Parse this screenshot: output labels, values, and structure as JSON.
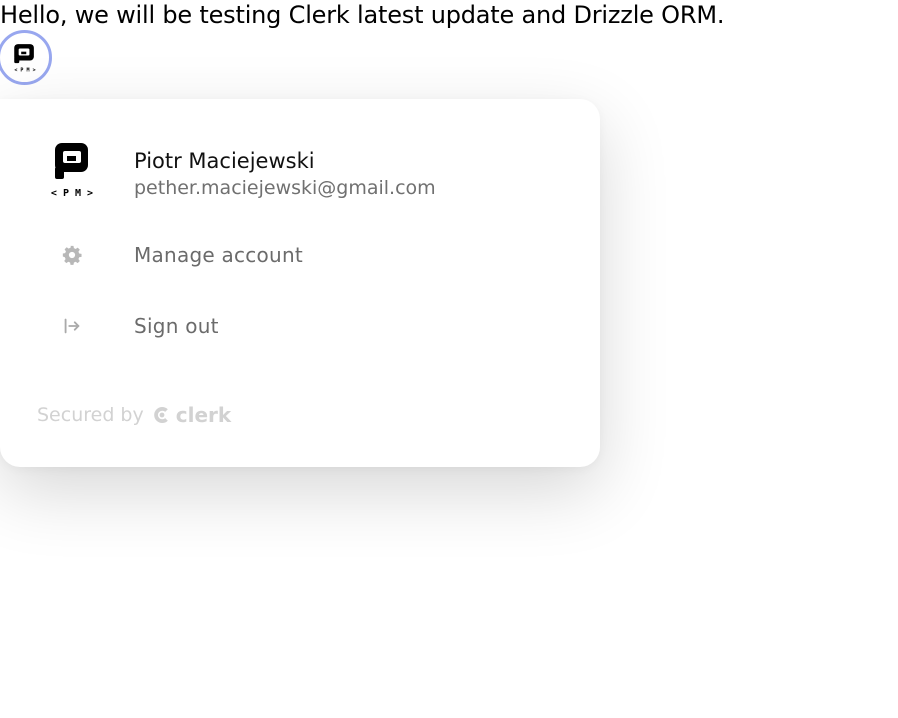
{
  "page": {
    "intro_text": "Hello, we will be testing Clerk latest update and Drizzle ORM."
  },
  "user_button": {
    "avatar_icon": "pm-logo-icon",
    "ring_color": "#98a7ef"
  },
  "popover": {
    "user": {
      "name": "Piotr Maciejewski",
      "email": "pether.maciejewski@gmail.com",
      "avatar_icon": "pm-logo-icon"
    },
    "menu": [
      {
        "label": "Manage account",
        "icon": "gear-icon"
      },
      {
        "label": "Sign out",
        "icon": "sign-out-icon"
      }
    ],
    "footer": {
      "secured_by": "Secured by",
      "brand": "clerk",
      "brand_icon": "clerk-logo-icon"
    }
  },
  "colors": {
    "text_primary": "#111111",
    "text_secondary": "#6b6b6b",
    "footer_text": "#d2d2d2",
    "background": "#ffffff"
  }
}
